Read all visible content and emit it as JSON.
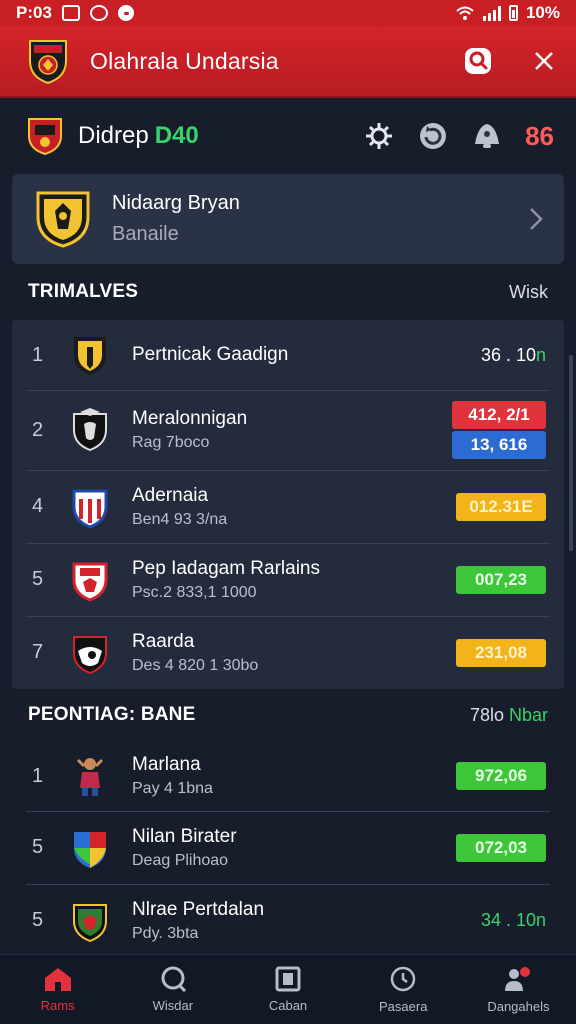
{
  "status_bar": {
    "time": "P:03",
    "battery": "10%"
  },
  "app_bar": {
    "title": "Olahrala Undarsia"
  },
  "header": {
    "title": "Didrep",
    "accent": "D40",
    "count": "86"
  },
  "profile": {
    "name": "Nidaarg Bryan",
    "subtitle": "Banaile"
  },
  "section1": {
    "title": "TRIMALVES",
    "action": "Wisk",
    "rows": [
      {
        "rank": "1",
        "name": "Pertnicak Gaadign",
        "sub": "",
        "score": "36 . 10",
        "score_accent": "n"
      },
      {
        "rank": "2",
        "name": "Meralonnigan",
        "sub": "Rag 7boco",
        "score_top": "412, 2/1",
        "score_bottom": "13, 616"
      },
      {
        "rank": "4",
        "name": "Adernaia",
        "sub": "Ben4 93 3/na",
        "score": "012.31E"
      },
      {
        "rank": "5",
        "name": "Pep Iadagam Rarlains",
        "sub": "Psc.2 833,1 1000",
        "score": "007,23"
      },
      {
        "rank": "7",
        "name": "Raarda",
        "sub": "Des 4 820 1 30bo",
        "score": "231,08"
      }
    ]
  },
  "section2": {
    "title": "PEONTIAG: BANE",
    "action": "78lo",
    "action_accent": "Nbar",
    "rows": [
      {
        "rank": "1",
        "name": "Marlana",
        "sub": "Pay 4 1bna",
        "score": "972,06"
      },
      {
        "rank": "5",
        "name": "Nilan Birater",
        "sub": "Deag Plihoao",
        "score": "072,03"
      },
      {
        "rank": "5",
        "name": "Nlrae Pertdalan",
        "sub": "Pdy. 3bta",
        "score": "34 . 10",
        "score_accent": "n"
      }
    ]
  },
  "nav": [
    {
      "label": "Rams",
      "icon": "home-icon"
    },
    {
      "label": "Wisdar",
      "icon": "chat-icon"
    },
    {
      "label": "Caban",
      "icon": "square-icon"
    },
    {
      "label": "Pasaera",
      "icon": "clock-icon"
    },
    {
      "label": "Dangahels",
      "icon": "people-icon"
    }
  ],
  "colors": {
    "primary": "#c81f25",
    "background": "#171d2b",
    "accent_green": "#39d36b",
    "accent_red": "#ff5a5a"
  }
}
